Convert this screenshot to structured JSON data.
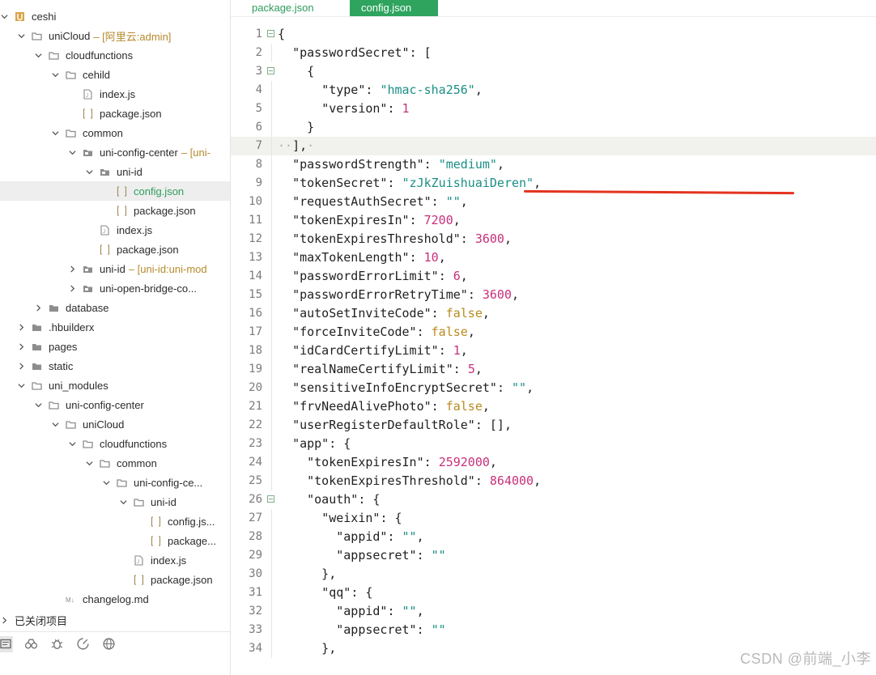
{
  "sidebar": {
    "tree": [
      {
        "label": "ceshi",
        "depth": 0,
        "arrow": "down",
        "icon": "project"
      },
      {
        "label": "uniCloud",
        "annotation": "– [阿里云:admin]",
        "depth": 1,
        "arrow": "down",
        "icon": "folder-open"
      },
      {
        "label": "cloudfunctions",
        "depth": 2,
        "arrow": "down",
        "icon": "folder-open"
      },
      {
        "label": "cehild",
        "depth": 3,
        "arrow": "down",
        "icon": "folder-open"
      },
      {
        "label": "index.js",
        "depth": 4,
        "arrow": "none",
        "icon": "file-js"
      },
      {
        "label": "package.json",
        "depth": 4,
        "arrow": "none",
        "icon": "file-json"
      },
      {
        "label": "common",
        "depth": 3,
        "arrow": "down",
        "icon": "folder-open"
      },
      {
        "label": "uni-config-center",
        "annotation": "– [uni-",
        "depth": 4,
        "arrow": "down",
        "icon": "folder-pkg"
      },
      {
        "label": "uni-id",
        "depth": 5,
        "arrow": "down",
        "icon": "folder-pkg"
      },
      {
        "label": "config.json",
        "depth": 6,
        "arrow": "none",
        "icon": "file-json",
        "selected": true
      },
      {
        "label": "package.json",
        "depth": 6,
        "arrow": "none",
        "icon": "file-json"
      },
      {
        "label": "index.js",
        "depth": 5,
        "arrow": "none",
        "icon": "file-js"
      },
      {
        "label": "package.json",
        "depth": 5,
        "arrow": "none",
        "icon": "file-json"
      },
      {
        "label": "uni-id",
        "annotation": "– [uni-id:uni-mod",
        "depth": 4,
        "arrow": "right",
        "icon": "folder-pkg"
      },
      {
        "label": "uni-open-bridge-co...",
        "depth": 4,
        "arrow": "right",
        "icon": "folder-pkg"
      },
      {
        "label": "database",
        "depth": 2,
        "arrow": "right",
        "icon": "folder"
      },
      {
        "label": ".hbuilderx",
        "depth": 1,
        "arrow": "right",
        "icon": "folder"
      },
      {
        "label": "pages",
        "depth": 1,
        "arrow": "right",
        "icon": "folder"
      },
      {
        "label": "static",
        "depth": 1,
        "arrow": "right",
        "icon": "folder"
      },
      {
        "label": "uni_modules",
        "depth": 1,
        "arrow": "down",
        "icon": "folder-open"
      },
      {
        "label": "uni-config-center",
        "depth": 2,
        "arrow": "down",
        "icon": "folder-open"
      },
      {
        "label": "uniCloud",
        "depth": 3,
        "arrow": "down",
        "icon": "folder-open"
      },
      {
        "label": "cloudfunctions",
        "depth": 4,
        "arrow": "down",
        "icon": "folder-open"
      },
      {
        "label": "common",
        "depth": 5,
        "arrow": "down",
        "icon": "folder-open"
      },
      {
        "label": "uni-config-ce...",
        "depth": 6,
        "arrow": "down",
        "icon": "folder-open"
      },
      {
        "label": "uni-id",
        "depth": 7,
        "arrow": "down",
        "icon": "folder-open"
      },
      {
        "label": "config.js...",
        "depth": 8,
        "arrow": "none",
        "icon": "file-json"
      },
      {
        "label": "package...",
        "depth": 8,
        "arrow": "none",
        "icon": "file-json"
      },
      {
        "label": "index.js",
        "depth": 7,
        "arrow": "none",
        "icon": "file-js"
      },
      {
        "label": "package.json",
        "depth": 7,
        "arrow": "none",
        "icon": "file-json"
      },
      {
        "label": "changelog.md",
        "depth": 3,
        "arrow": "none",
        "icon": "file-md"
      }
    ],
    "closed_projects_label": "已关闭项目",
    "toolbar_icons": [
      "project-manager-icon",
      "binoculars-icon",
      "debug-icon",
      "plugin-icon",
      "globe-icon"
    ]
  },
  "editor": {
    "tabs": [
      {
        "label": "package.json",
        "active": false
      },
      {
        "label": "config.json",
        "active": true
      }
    ],
    "current_line": 7,
    "lines": [
      {
        "n": "1",
        "fold": true,
        "tokens": [
          [
            "p",
            "{"
          ]
        ]
      },
      {
        "n": "2",
        "tokens": [
          [
            "p",
            "  "
          ],
          [
            "k",
            "\"passwordSecret\""
          ],
          [
            "p",
            ": ["
          ]
        ]
      },
      {
        "n": "3",
        "fold": true,
        "tokens": [
          [
            "p",
            "    {"
          ]
        ]
      },
      {
        "n": "4",
        "tokens": [
          [
            "p",
            "      "
          ],
          [
            "k",
            "\"type\""
          ],
          [
            "p",
            ": "
          ],
          [
            "s",
            "\"hmac-sha256\""
          ],
          [
            "p",
            ","
          ]
        ]
      },
      {
        "n": "5",
        "tokens": [
          [
            "p",
            "      "
          ],
          [
            "k",
            "\"version\""
          ],
          [
            "p",
            ": "
          ],
          [
            "n",
            "1"
          ]
        ]
      },
      {
        "n": "6",
        "tokens": [
          [
            "p",
            "    }"
          ]
        ]
      },
      {
        "n": "7",
        "tokens": [
          [
            "dots",
            "··"
          ],
          [
            "p",
            "],"
          ],
          [
            "dots",
            "·"
          ]
        ]
      },
      {
        "n": "8",
        "tokens": [
          [
            "p",
            "  "
          ],
          [
            "k",
            "\"passwordStrength\""
          ],
          [
            "p",
            ": "
          ],
          [
            "s",
            "\"medium\""
          ],
          [
            "p",
            ","
          ]
        ]
      },
      {
        "n": "9",
        "tokens": [
          [
            "p",
            "  "
          ],
          [
            "k",
            "\"tokenSecret\""
          ],
          [
            "p",
            ": "
          ],
          [
            "s",
            "\"zJkZuishuaiDeren\""
          ],
          [
            "p",
            ","
          ]
        ]
      },
      {
        "n": "10",
        "tokens": [
          [
            "p",
            "  "
          ],
          [
            "k",
            "\"requestAuthSecret\""
          ],
          [
            "p",
            ": "
          ],
          [
            "s",
            "\"\""
          ],
          [
            "p",
            ","
          ]
        ]
      },
      {
        "n": "11",
        "tokens": [
          [
            "p",
            "  "
          ],
          [
            "k",
            "\"tokenExpiresIn\""
          ],
          [
            "p",
            ": "
          ],
          [
            "n",
            "7200"
          ],
          [
            "p",
            ","
          ]
        ]
      },
      {
        "n": "12",
        "tokens": [
          [
            "p",
            "  "
          ],
          [
            "k",
            "\"tokenExpiresThreshold\""
          ],
          [
            "p",
            ": "
          ],
          [
            "n",
            "3600"
          ],
          [
            "p",
            ","
          ]
        ]
      },
      {
        "n": "13",
        "tokens": [
          [
            "p",
            "  "
          ],
          [
            "k",
            "\"maxTokenLength\""
          ],
          [
            "p",
            ": "
          ],
          [
            "n",
            "10"
          ],
          [
            "p",
            ","
          ]
        ]
      },
      {
        "n": "14",
        "tokens": [
          [
            "p",
            "  "
          ],
          [
            "k",
            "\"passwordErrorLimit\""
          ],
          [
            "p",
            ": "
          ],
          [
            "n",
            "6"
          ],
          [
            "p",
            ","
          ]
        ]
      },
      {
        "n": "15",
        "tokens": [
          [
            "p",
            "  "
          ],
          [
            "k",
            "\"passwordErrorRetryTime\""
          ],
          [
            "p",
            ": "
          ],
          [
            "n",
            "3600"
          ],
          [
            "p",
            ","
          ]
        ]
      },
      {
        "n": "16",
        "tokens": [
          [
            "p",
            "  "
          ],
          [
            "k",
            "\"autoSetInviteCode\""
          ],
          [
            "p",
            ": "
          ],
          [
            "b",
            "false"
          ],
          [
            "p",
            ","
          ]
        ]
      },
      {
        "n": "17",
        "tokens": [
          [
            "p",
            "  "
          ],
          [
            "k",
            "\"forceInviteCode\""
          ],
          [
            "p",
            ": "
          ],
          [
            "b",
            "false"
          ],
          [
            "p",
            ","
          ]
        ]
      },
      {
        "n": "18",
        "tokens": [
          [
            "p",
            "  "
          ],
          [
            "k",
            "\"idCardCertifyLimit\""
          ],
          [
            "p",
            ": "
          ],
          [
            "n",
            "1"
          ],
          [
            "p",
            ","
          ]
        ]
      },
      {
        "n": "19",
        "tokens": [
          [
            "p",
            "  "
          ],
          [
            "k",
            "\"realNameCertifyLimit\""
          ],
          [
            "p",
            ": "
          ],
          [
            "n",
            "5"
          ],
          [
            "p",
            ","
          ]
        ]
      },
      {
        "n": "20",
        "tokens": [
          [
            "p",
            "  "
          ],
          [
            "k",
            "\"sensitiveInfoEncryptSecret\""
          ],
          [
            "p",
            ": "
          ],
          [
            "s",
            "\"\""
          ],
          [
            "p",
            ","
          ]
        ]
      },
      {
        "n": "21",
        "tokens": [
          [
            "p",
            "  "
          ],
          [
            "k",
            "\"frvNeedAlivePhoto\""
          ],
          [
            "p",
            ": "
          ],
          [
            "b",
            "false"
          ],
          [
            "p",
            ","
          ]
        ]
      },
      {
        "n": "22",
        "tokens": [
          [
            "p",
            "  "
          ],
          [
            "k",
            "\"userRegisterDefaultRole\""
          ],
          [
            "p",
            ": [],"
          ]
        ]
      },
      {
        "n": "23",
        "tokens": [
          [
            "p",
            "  "
          ],
          [
            "k",
            "\"app\""
          ],
          [
            "p",
            ": {"
          ]
        ]
      },
      {
        "n": "24",
        "tokens": [
          [
            "p",
            "    "
          ],
          [
            "k",
            "\"tokenExpiresIn\""
          ],
          [
            "p",
            ": "
          ],
          [
            "n",
            "2592000"
          ],
          [
            "p",
            ","
          ]
        ]
      },
      {
        "n": "25",
        "tokens": [
          [
            "p",
            "    "
          ],
          [
            "k",
            "\"tokenExpiresThreshold\""
          ],
          [
            "p",
            ": "
          ],
          [
            "n",
            "864000"
          ],
          [
            "p",
            ","
          ]
        ]
      },
      {
        "n": "26",
        "fold": true,
        "tokens": [
          [
            "p",
            "    "
          ],
          [
            "k",
            "\"oauth\""
          ],
          [
            "p",
            ": {"
          ]
        ]
      },
      {
        "n": "27",
        "tokens": [
          [
            "p",
            "      "
          ],
          [
            "k",
            "\"weixin\""
          ],
          [
            "p",
            ": {"
          ]
        ]
      },
      {
        "n": "28",
        "tokens": [
          [
            "p",
            "        "
          ],
          [
            "k",
            "\"appid\""
          ],
          [
            "p",
            ": "
          ],
          [
            "s",
            "\"\""
          ],
          [
            "p",
            ","
          ]
        ]
      },
      {
        "n": "29",
        "tokens": [
          [
            "p",
            "        "
          ],
          [
            "k",
            "\"appsecret\""
          ],
          [
            "p",
            ": "
          ],
          [
            "s",
            "\"\""
          ]
        ]
      },
      {
        "n": "30",
        "tokens": [
          [
            "p",
            "      },"
          ]
        ]
      },
      {
        "n": "31",
        "tokens": [
          [
            "p",
            "      "
          ],
          [
            "k",
            "\"qq\""
          ],
          [
            "p",
            ": {"
          ]
        ]
      },
      {
        "n": "32",
        "tokens": [
          [
            "p",
            "        "
          ],
          [
            "k",
            "\"appid\""
          ],
          [
            "p",
            ": "
          ],
          [
            "s",
            "\"\""
          ],
          [
            "p",
            ","
          ]
        ]
      },
      {
        "n": "33",
        "tokens": [
          [
            "p",
            "        "
          ],
          [
            "k",
            "\"appsecret\""
          ],
          [
            "p",
            ": "
          ],
          [
            "s",
            "\"\""
          ]
        ]
      },
      {
        "n": "34",
        "tokens": [
          [
            "p",
            "      },"
          ]
        ]
      }
    ]
  },
  "watermark": "CSDN @前端_小李",
  "colors": {
    "accent": "#2ea45e",
    "string": "#1a8f86",
    "number": "#c8307a",
    "boolean": "#b98a1e",
    "underline": "#e3331f"
  }
}
